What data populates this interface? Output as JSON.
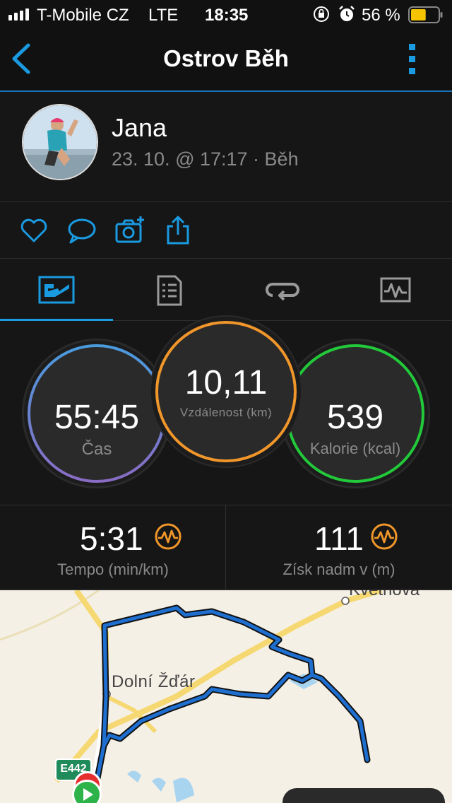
{
  "status_bar": {
    "carrier": "T-Mobile CZ",
    "network": "LTE",
    "time": "18:35",
    "battery_percent": "56 %",
    "battery_level": 0.56,
    "icons": [
      "signal-icon",
      "lock-rotation-icon",
      "alarm-icon",
      "battery-icon"
    ]
  },
  "nav": {
    "title": "Ostrov Běh",
    "back_icon": "chevron-left-icon",
    "more_icon": "more-vertical-icon",
    "accent_color": "#1a9ae0"
  },
  "profile": {
    "name": "Jana",
    "meta": "23. 10. @ 17:17 · Běh"
  },
  "actions": [
    "heart-icon",
    "comment-icon",
    "add-photo-icon",
    "share-icon"
  ],
  "tabs": [
    {
      "icon": "stats-tab-icon",
      "active": true
    },
    {
      "icon": "details-tab-icon",
      "active": false
    },
    {
      "icon": "laps-tab-icon",
      "active": false
    },
    {
      "icon": "charts-tab-icon",
      "active": false
    }
  ],
  "stats": {
    "time": {
      "value": "55:45",
      "label": "Čas"
    },
    "distance": {
      "value": "10,11",
      "label": "Vzdálenost (km)"
    },
    "calories": {
      "value": "539",
      "label": "Kalorie (kcal)"
    }
  },
  "metrics": {
    "pace": {
      "value": "5:31",
      "label": "Tempo (min/km)"
    },
    "elevation": {
      "value": "111",
      "label": "Získ nadm v (m)"
    }
  },
  "map": {
    "town": "Dolní Žďár",
    "town2": "Květnová",
    "road_shield": "E442"
  },
  "colors": {
    "time_ring": "#4a8fd8",
    "distance_ring": "#f0962a",
    "calories_ring": "#22c93a",
    "route": "#1e6fd0",
    "hr_icon": "#f0962a"
  }
}
